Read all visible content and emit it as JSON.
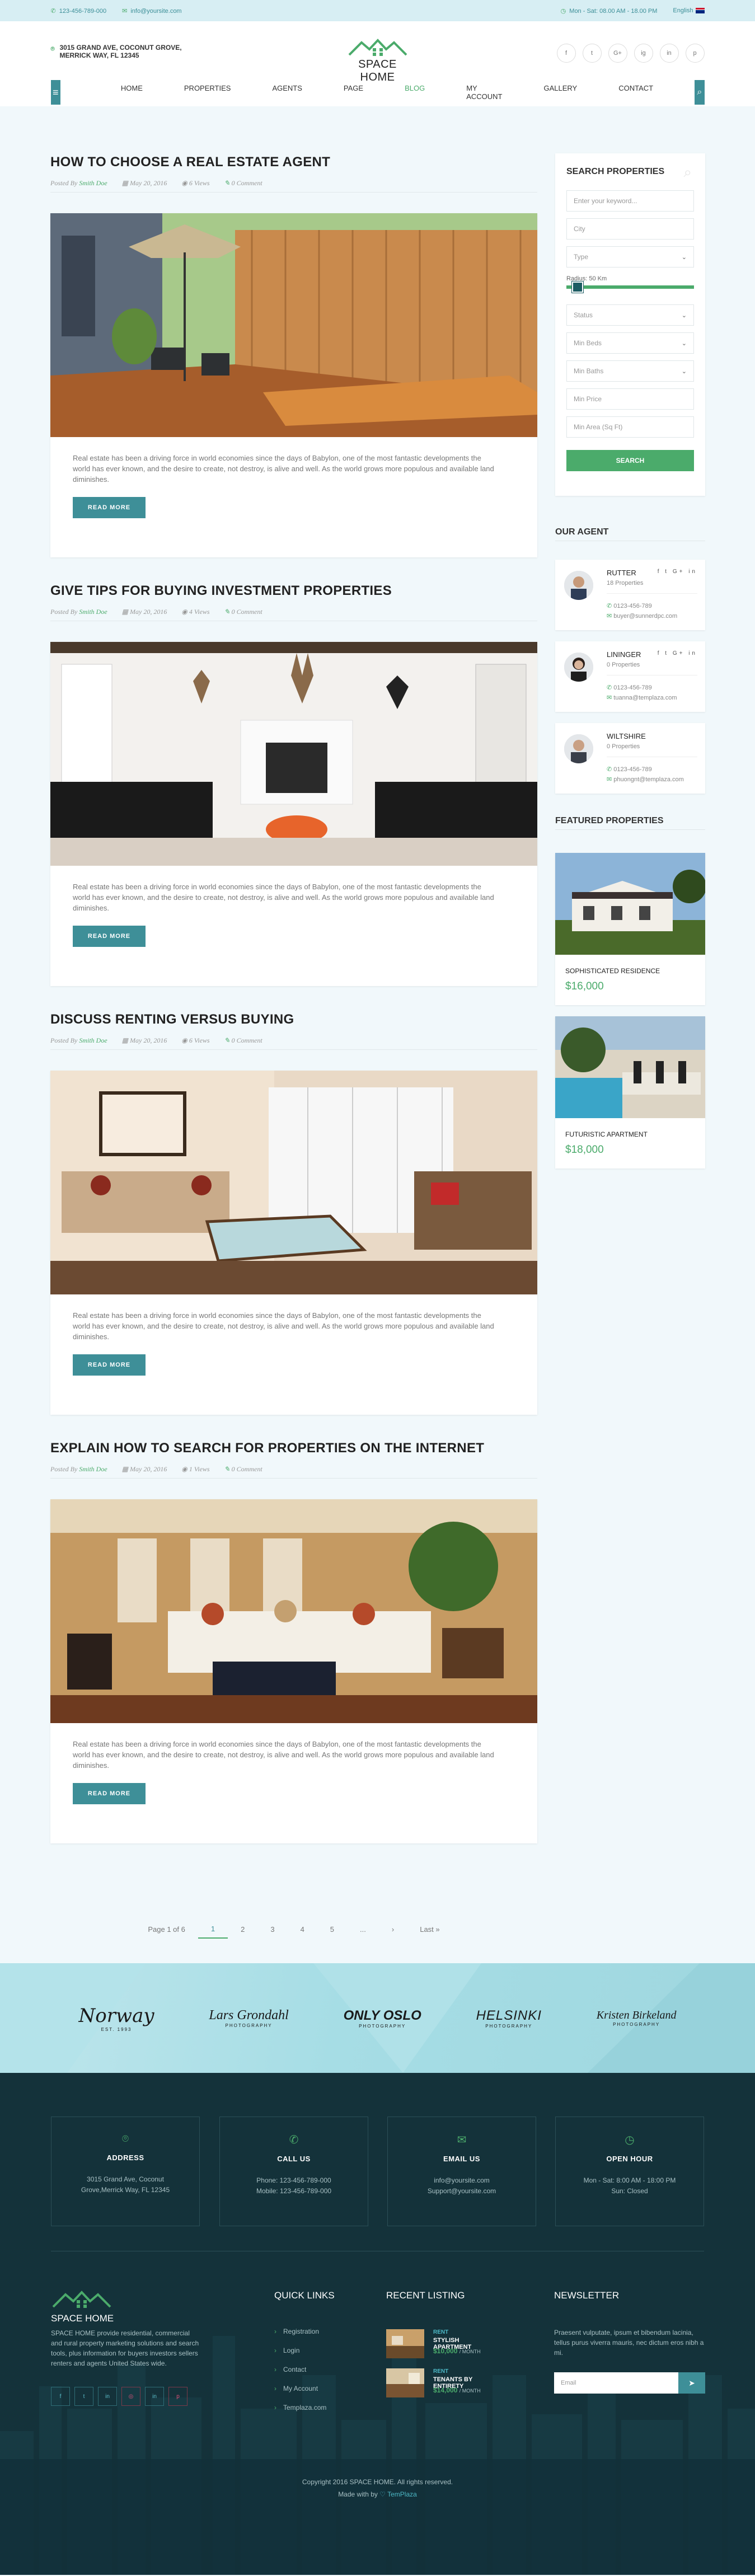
{
  "topbar": {
    "phone": "123-456-789-000",
    "email": "info@yoursite.com",
    "hours": "Mon - Sat: 08.00 AM - 18.00 PM",
    "language": "English"
  },
  "header": {
    "address": "3015 GRAND AVE, COCONUT GROVE, MERRICK WAY, FL 12345",
    "logo_text": "SPACE HOME",
    "social": [
      "f",
      "t",
      "G+",
      "ig",
      "in",
      "p"
    ]
  },
  "nav": {
    "items": [
      "HOME",
      "PROPERTIES",
      "AGENTS",
      "PAGE",
      "BLOG",
      "MY ACCOUNT",
      "GALLERY",
      "CONTACT"
    ],
    "active": "BLOG"
  },
  "posts": [
    {
      "title": "HOW TO CHOOSE A REAL ESTATE AGENT",
      "author_prefix": "Posted By",
      "author": "Smith Doe",
      "date": "May 20, 2016",
      "views": "6 Views",
      "comments": "0 Comment",
      "excerpt": "Real estate has been a driving force in world economies since the days of Babylon, one of the most fantastic developments the world has ever known, and the desire to create, not destroy, is alive and well. As the world grows more populous and available land diminishes.",
      "button": "READ MORE"
    },
    {
      "title": "GIVE TIPS FOR BUYING INVESTMENT PROPERTIES",
      "author_prefix": "Posted By",
      "author": "Smith Doe",
      "date": "May 20, 2016",
      "views": "4 Views",
      "comments": "0 Comment",
      "excerpt": "Real estate has been a driving force in world economies since the days of Babylon, one of the most fantastic developments the world has ever known, and the desire to create, not destroy, is alive and well. As the world grows more populous and available land diminishes.",
      "button": "READ MORE"
    },
    {
      "title": "DISCUSS RENTING VERSUS BUYING",
      "author_prefix": "Posted By",
      "author": "Smith Doe",
      "date": "May 20, 2016",
      "views": "6 Views",
      "comments": "0 Comment",
      "excerpt": "Real estate has been a driving force in world economies since the days of Babylon, one of the most fantastic developments the world has ever known, and the desire to create, not destroy, is alive and well. As the world grows more populous and available land diminishes.",
      "button": "READ MORE"
    },
    {
      "title": "EXPLAIN HOW TO SEARCH FOR PROPERTIES ON THE INTERNET",
      "author_prefix": "Posted By",
      "author": "Smith Doe",
      "date": "May 20, 2016",
      "views": "1 Views",
      "comments": "0 Comment",
      "excerpt": "Real estate has been a driving force in world economies since the days of Babylon, one of the most fantastic developments the world has ever known, and the desire to create, not destroy, is alive and well. As the world grows more populous and available land diminishes.",
      "button": "READ MORE"
    }
  ],
  "pagination": {
    "label": "Page 1 of 6",
    "pages": [
      "1",
      "2",
      "3",
      "4",
      "5",
      "...",
      "›",
      "Last »"
    ],
    "current": "1"
  },
  "search": {
    "heading": "SEARCH PROPERTIES",
    "keyword_placeholder": "Enter your keyword...",
    "city": "City",
    "type": "Type",
    "radius_label": "Radius: 50 Km",
    "radius_value_km": 50,
    "status": "Status",
    "min_beds": "Min Beds",
    "min_baths": "Min Baths",
    "min_price": "Min Price",
    "min_area": "Min Area (Sq Ft)",
    "button": "SEARCH"
  },
  "agents": {
    "heading": "OUR AGENT",
    "list": [
      {
        "name": "RUTTER",
        "properties": "18 Properties",
        "phone": "0123-456-789",
        "email": "buyer@sunnerdpc.com",
        "social": "f t G+ in"
      },
      {
        "name": "LININGER",
        "properties": "0 Properties",
        "phone": "0123-456-789",
        "email": "tuanna@templaza.com",
        "social": "f t G+ in"
      },
      {
        "name": "WILTSHIRE",
        "properties": "0 Properties",
        "phone": "0123-456-789",
        "email": "phuongnt@templaza.com",
        "social": ""
      }
    ]
  },
  "featured": {
    "heading": "FEATURED PROPERTIES",
    "list": [
      {
        "name": "SOPHISTICATED RESIDENCE",
        "price": "$16,000"
      },
      {
        "name": "FUTURISTIC APARTMENT",
        "price": "$18,000"
      }
    ]
  },
  "partners": [
    {
      "name": "Norway",
      "tag": "EST. 1993"
    },
    {
      "name": "Lars Grondahl",
      "tag": "PHOTOGRAPHY"
    },
    {
      "name": "ONLY OSLO",
      "tag": "PHOTOGRAPHY"
    },
    {
      "name": "HELSINKI",
      "tag": "PHOTOGRAPHY"
    },
    {
      "name": "Kristen Birkeland",
      "tag": "PHOTOGRAPHY"
    }
  ],
  "footer": {
    "cards": [
      {
        "title": "ADDRESS",
        "lines": [
          "3015 Grand Ave, Coconut",
          "Grove,Merrick Way, FL 12345"
        ]
      },
      {
        "title": "CALL US",
        "lines": [
          "Phone: 123-456-789-000",
          "Mobile: 123-456-789-000"
        ]
      },
      {
        "title": "EMAIL US",
        "lines": [
          "info@yoursite.com",
          "Support@yoursite.com"
        ]
      },
      {
        "title": "OPEN HOUR",
        "lines": [
          "Mon - Sat: 8:00 AM - 18:00 PM",
          "Sun: Closed"
        ]
      }
    ],
    "logo_text": "SPACE HOME",
    "about": "SPACE HOME provide residential, commercial and rural property marketing solutions and search tools, plus information for buyers investors sellers renters and agents United States wide.",
    "quick_links_heading": "QUICK LINKS",
    "quick_links": [
      "Registration",
      "Login",
      "Contact",
      "My Account",
      "Templaza.com"
    ],
    "recent_heading": "RECENT LISTING",
    "recent": [
      {
        "tag": "RENT",
        "name": "STYLISH APARTMENT",
        "price": "$10,000",
        "unit": "/ MONTH"
      },
      {
        "tag": "RENT",
        "name": "TENANTS BY ENTIRETY",
        "price": "$14,000",
        "unit": "/ MONTH"
      }
    ],
    "newsletter_heading": "NEWSLETTER",
    "newsletter_text": "Praesent vulputate, ipsum et bibendum lacinia, tellus purus viverra mauris, nec dictum eros nibh a mi.",
    "email_placeholder": "Email",
    "copyright": "Copyright 2016 SPACE HOME. All rights reserved.",
    "made_by_prefix": "Made with by",
    "made_by": "TemPlaza"
  },
  "colors": {
    "teal": "#3e8f98",
    "green": "#4bab6b",
    "footer_bg": "#14323a",
    "page_bg": "#f1f8fb"
  }
}
